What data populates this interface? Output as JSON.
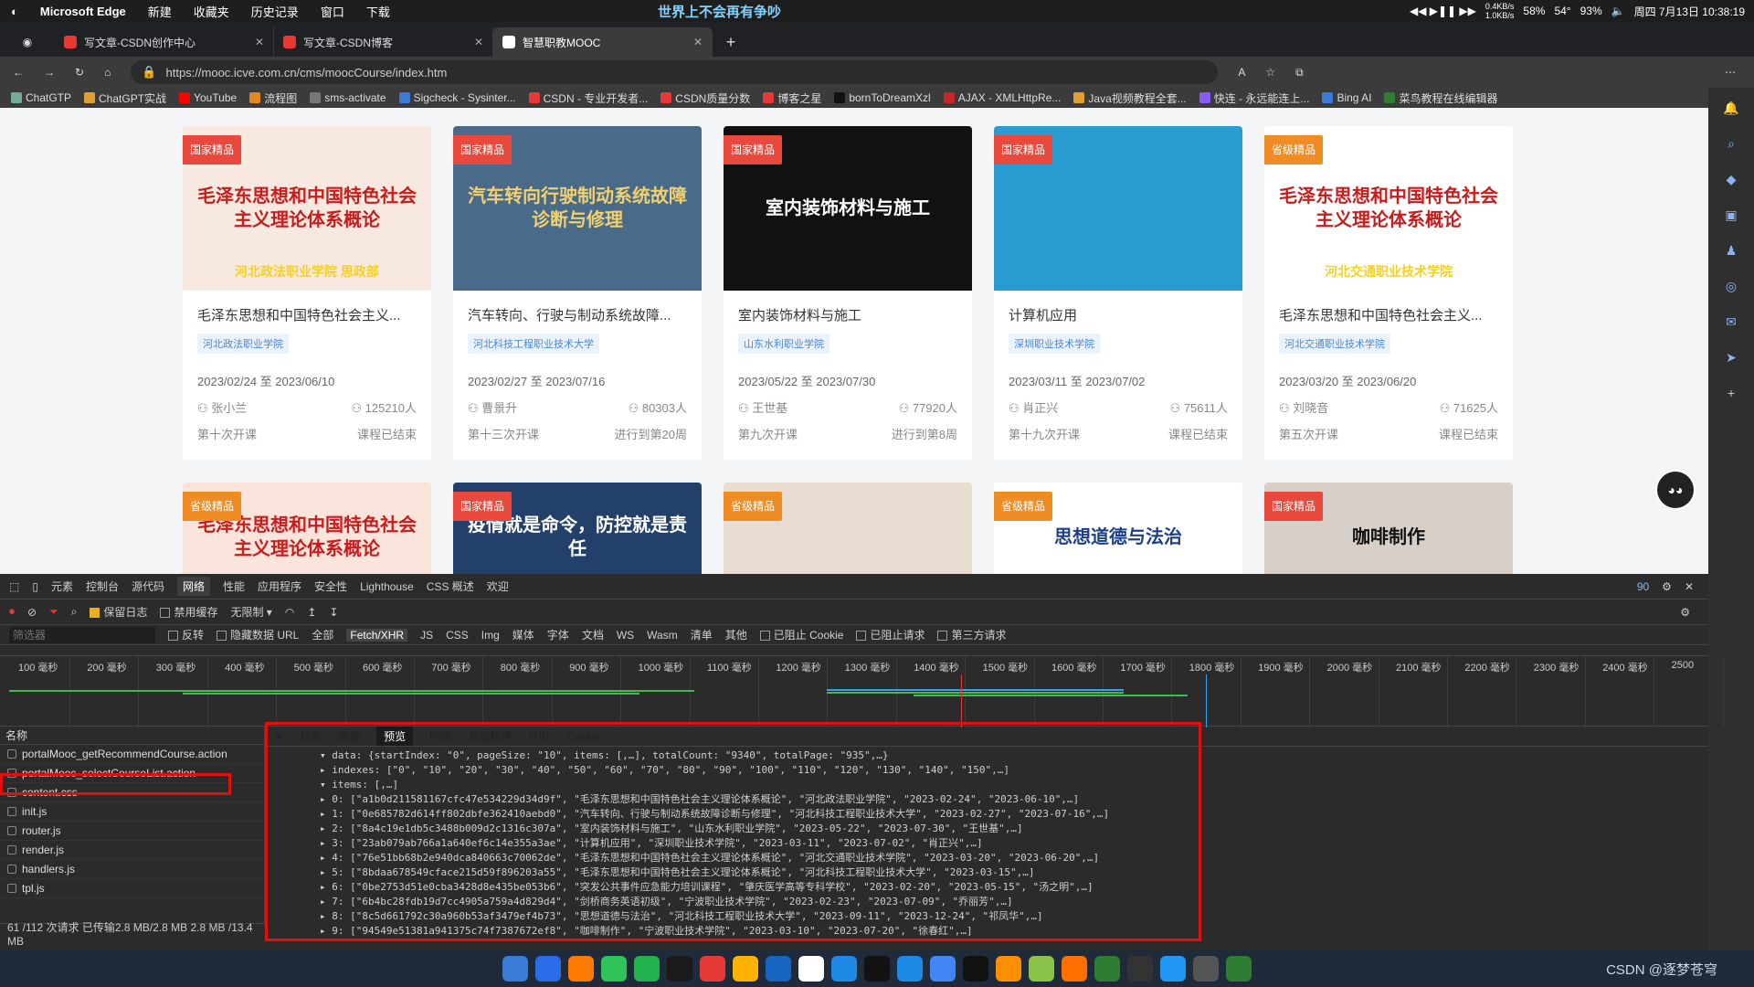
{
  "menubar": {
    "apple": "",
    "app": "Microsoft Edge",
    "items": [
      "新建",
      "收藏夹",
      "历史记录",
      "窗口",
      "下载"
    ],
    "center_text": "世界上不会再有争吵",
    "net_up": "0.4KB/s",
    "net_down": "1.0KB/s",
    "cpu": "58%",
    "temp": "54°",
    "battery": "93%",
    "datetime": "周四 7月13日 10:38:19"
  },
  "tabs": [
    {
      "label": "写文章-CSDN创作中心"
    },
    {
      "label": "写文章-CSDN博客"
    },
    {
      "label": "智慧职教MOOC"
    }
  ],
  "address": {
    "url": "https://mooc.icve.com.cn/cms/moocCourse/index.htm"
  },
  "bookmarks": [
    "ChatGTP",
    "ChatGPT实战",
    "YouTube",
    "流程图",
    "sms-activate",
    "Sigcheck - Sysinter...",
    "CSDN - 专业开发者...",
    "CSDN质量分数",
    "博客之星",
    "bornToDreamXzl",
    "AJAX - XMLHttpRe...",
    "Java视频教程全套...",
    "快连 - 永远能连上...",
    "Bing AI",
    "菜鸟教程在线编辑器"
  ],
  "courses": [
    {
      "badge": "国家精品",
      "img_text": "毛泽东思想和中国特色社会主义理论体系概论",
      "img_sub": "河北政法职业学院    思政部",
      "title": "毛泽东思想和中国特色社会主义...",
      "school": "河北政法职业学院",
      "date": "2023/02/24 至 2023/06/10",
      "teacher": "张小兰",
      "count": "125210人",
      "session": "第十次开课",
      "status": "课程已结束",
      "color": "#c81d1d",
      "bg": "#f7e8e0"
    },
    {
      "badge": "国家精品",
      "img_text": "汽车转向行驶制动系统故障诊断与修理",
      "img_sub": "",
      "title": "汽车转向、行驶与制动系统故障...",
      "school": "河北科技工程职业技术大学",
      "date": "2023/02/27 至 2023/07/16",
      "teacher": "曹景升",
      "count": "80303人",
      "session": "第十三次开课",
      "status": "进行到第20周",
      "color": "#f0d070",
      "bg": "#4a6a8a"
    },
    {
      "badge": "国家精品",
      "img_text": "室内装饰材料与施工",
      "img_sub": "",
      "title": "室内装饰材料与施工",
      "school": "山东水利职业学院",
      "date": "2023/05/22 至 2023/07/30",
      "teacher": "王世基",
      "count": "77920人",
      "session": "第九次开课",
      "status": "进行到第8周",
      "color": "#ffffff",
      "bg": "#111111"
    },
    {
      "badge": "国家精品",
      "img_text": "",
      "img_sub": "",
      "title": "计算机应用",
      "school": "深圳职业技术学院",
      "date": "2023/03/11 至 2023/07/02",
      "teacher": "肖正兴",
      "count": "75611人",
      "session": "第十九次开课",
      "status": "课程已结束",
      "color": "#ffffff",
      "bg": "#2a9bd0"
    },
    {
      "badge": "省级精品",
      "img_text": "毛泽东思想和中国特色社会主义理论体系概论",
      "img_sub": "河北交通职业技术学院",
      "title": "毛泽东思想和中国特色社会主义...",
      "school": "河北交通职业技术学院",
      "date": "2023/03/20 至 2023/06/20",
      "teacher": "刘晓音",
      "count": "71625人",
      "session": "第五次开课",
      "status": "课程已结束",
      "color": "#c81d1d",
      "bg": "#ffffff"
    }
  ],
  "courses_row2": [
    {
      "badge": "省级精品",
      "img_text": "毛泽东思想和中国特色社会主义理论体系概论",
      "color": "#c81d1d",
      "bg": "#fbe4dc"
    },
    {
      "badge": "国家精品",
      "img_text": "疫情就是命令，防控就是责任",
      "color": "#ffffff",
      "bg": "#23406a"
    },
    {
      "badge": "省级精品",
      "img_text": "",
      "color": "#333333",
      "bg": "#e8ddd0"
    },
    {
      "badge": "省级精品",
      "img_text": "思想道德与法治",
      "color": "#1b3f8a",
      "bg": "#ffffff"
    },
    {
      "badge": "国家精品",
      "img_text": "咖啡制作",
      "color": "#111111",
      "bg": "#d8d0c8"
    }
  ],
  "devtools": {
    "tabs": [
      "元素",
      "控制台",
      "源代码",
      "网络",
      "性能",
      "应用程序",
      "安全性",
      "Lighthouse",
      "CSS 概述",
      "欢迎"
    ],
    "active_tab": "网络",
    "issues": "90",
    "toolbar": {
      "preserve_log": "保留日志",
      "disable_cache": "禁用缓存",
      "throttle": "无限制"
    },
    "filter_placeholder": "筛选器",
    "filters": [
      "反转",
      "隐藏数据 URL",
      "全部",
      "Fetch/XHR",
      "JS",
      "CSS",
      "Img",
      "媒体",
      "字体",
      "文档",
      "WS",
      "Wasm",
      "清单",
      "其他",
      "已阻止 Cookie",
      "已阻止请求",
      "第三方请求"
    ],
    "ticks": [
      "100 毫秒",
      "200 毫秒",
      "300 毫秒",
      "400 毫秒",
      "500 毫秒",
      "600 毫秒",
      "700 毫秒",
      "800 毫秒",
      "900 毫秒",
      "1000 毫秒",
      "1100 毫秒",
      "1200 毫秒",
      "1300 毫秒",
      "1400 毫秒",
      "1500 毫秒",
      "1600 毫秒",
      "1700 毫秒",
      "1800 毫秒",
      "1900 毫秒",
      "2000 毫秒",
      "2100 毫秒",
      "2200 毫秒",
      "2300 毫秒",
      "2400 毫秒",
      "2500"
    ],
    "name_header": "名称",
    "requests": [
      "portalMooc_getRecommendCourse.action",
      "portalMooc_selectCourseList.action",
      "content.css",
      "init.js",
      "router.js",
      "render.js",
      "handlers.js",
      "tpl.js"
    ],
    "status": "61 /112 次请求  已传输2.8 MB/2.8 MB  2.8 MB /13.4 MB",
    "preview_tabs": [
      "标头",
      "负载",
      "预览",
      "响应",
      "发起程序",
      "计时",
      "Cookie"
    ],
    "preview_active": "预览",
    "code_lines": [
      "▾ data: {startIndex: \"0\", pageSize: \"10\", items: [,…], totalCount: \"9340\", totalPage: \"935\",…}",
      "  ▸ indexes: [\"0\", \"10\", \"20\", \"30\", \"40\", \"50\", \"60\", \"70\", \"80\", \"90\", \"100\", \"110\", \"120\", \"130\", \"140\", \"150\",…]",
      "  ▾ items: [,…]",
      "    ▸ 0: [\"a1b0d211581167cfc47e534229d34d9f\", \"毛泽东思想和中国特色社会主义理论体系概论\", \"河北政法职业学院\", \"2023-02-24\", \"2023-06-10\",…]",
      "    ▸ 1: [\"0e685782d614ff802dbfe362410aebd0\", \"汽车转向、行驶与制动系统故障诊断与修理\", \"河北科技工程职业技术大学\", \"2023-02-27\", \"2023-07-16\",…]",
      "    ▸ 2: [\"8a4c19e1db5c3488b009d2c1316c307a\", \"室内装饰材料与施工\", \"山东水利职业学院\", \"2023-05-22\", \"2023-07-30\", \"王世基\",…]",
      "    ▸ 3: [\"23ab079ab766a1a640ef6c14e355a3ae\", \"计算机应用\", \"深圳职业技术学院\", \"2023-03-11\", \"2023-07-02\", \"肖正兴\",…]",
      "    ▸ 4: [\"76e51bb68b2e940dca840663c70062de\", \"毛泽东思想和中国特色社会主义理论体系概论\", \"河北交通职业技术学院\", \"2023-03-20\", \"2023-06-20\",…]",
      "    ▸ 5: [\"8bdaa678549cface215d59f896203a55\", \"毛泽东思想和中国特色社会主义理论体系概论\", \"河北科技工程职业技术大学\", \"2023-03-15\",…]",
      "    ▸ 6: [\"0be2753d51e0cba3428d8e435be053b6\", \"突发公共事件应急能力培训课程\", \"肇庆医学高等专科学校\", \"2023-02-20\", \"2023-05-15\", \"汤之明\",…]",
      "    ▸ 7: [\"6b4bc28fdb19d7cc4905a759a4d829d4\", \"剑桥商务英语初级\", \"宁波职业技术学院\", \"2023-02-23\", \"2023-07-09\", \"乔丽芳\",…]",
      "    ▸ 8: [\"8c5d661792c30a960b53af3479ef4b73\", \"思想道德与法治\", \"河北科技工程职业技术大学\", \"2023-09-11\", \"2023-12-24\", \"祁凤华\",…]",
      "    ▸ 9: [\"94549e51381a941375c74f7387672ef8\", \"咖啡制作\", \"宁波职业技术学院\", \"2023-03-10\", \"2023-07-20\", \"徐春红\",…]"
    ]
  },
  "watermark": "CSDN @逐梦苍穹"
}
